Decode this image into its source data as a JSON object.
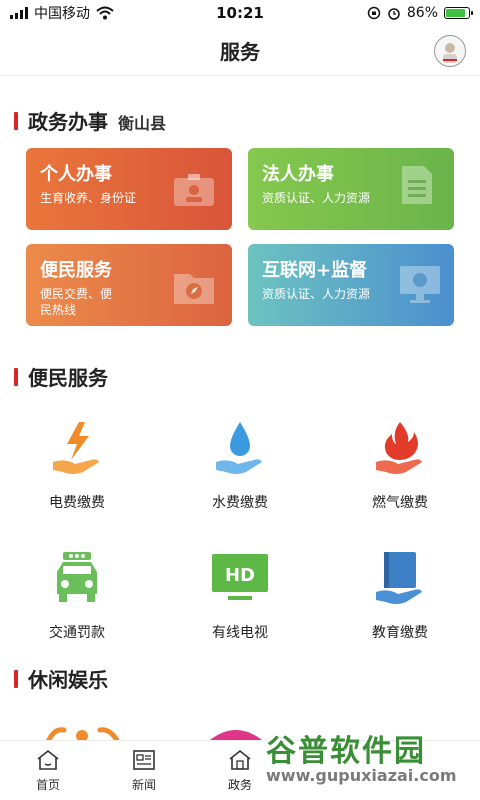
{
  "status_bar": {
    "carrier": "中国移动",
    "time": "10:21",
    "battery_text": "86%",
    "battery_level": 0.86
  },
  "header": {
    "title": "服务"
  },
  "gov_section": {
    "title": "政务办事",
    "location": "衡山县",
    "cards": [
      {
        "title": "个人办事",
        "desc": "生育收养、身份证",
        "icon": "id-card-icon"
      },
      {
        "title": "法人办事",
        "desc": "资质认证、人力资源",
        "icon": "document-icon"
      },
      {
        "title": "便民服务",
        "desc": "便民交费、便民热线",
        "icon": "folder-compass-icon"
      },
      {
        "title": "互联网+监督",
        "desc": "资质认证、人力资源",
        "icon": "monitor-icon"
      }
    ]
  },
  "convenience_section": {
    "title": "便民服务",
    "items": [
      {
        "label": "电费缴费",
        "icon": "electricity-icon"
      },
      {
        "label": "水费缴费",
        "icon": "water-icon"
      },
      {
        "label": "燃气缴费",
        "icon": "gas-flame-icon"
      },
      {
        "label": "交通罚款",
        "icon": "car-icon"
      },
      {
        "label": "有线电视",
        "icon": "hd-tv-icon"
      },
      {
        "label": "教育缴费",
        "icon": "book-icon"
      }
    ]
  },
  "leisure_section": {
    "title": "休闲娱乐"
  },
  "bottom_nav": [
    {
      "label": "首页",
      "icon": "home-icon"
    },
    {
      "label": "新闻",
      "icon": "news-icon"
    },
    {
      "label": "政务",
      "icon": "government-icon"
    }
  ],
  "watermark": {
    "title": "谷普软件园",
    "url": "www.gupuxiazai.com"
  },
  "colors": {
    "accent_red": "#d8262e",
    "card_orange": "#e8703a",
    "card_green": "#7cc24e",
    "card_orange2": "#e9814a",
    "card_teal": "#5fb3c4",
    "icon_orange": "#f08a2a",
    "icon_blue": "#3b9ae0",
    "icon_red": "#e23b2a",
    "icon_green": "#6abf5a"
  }
}
